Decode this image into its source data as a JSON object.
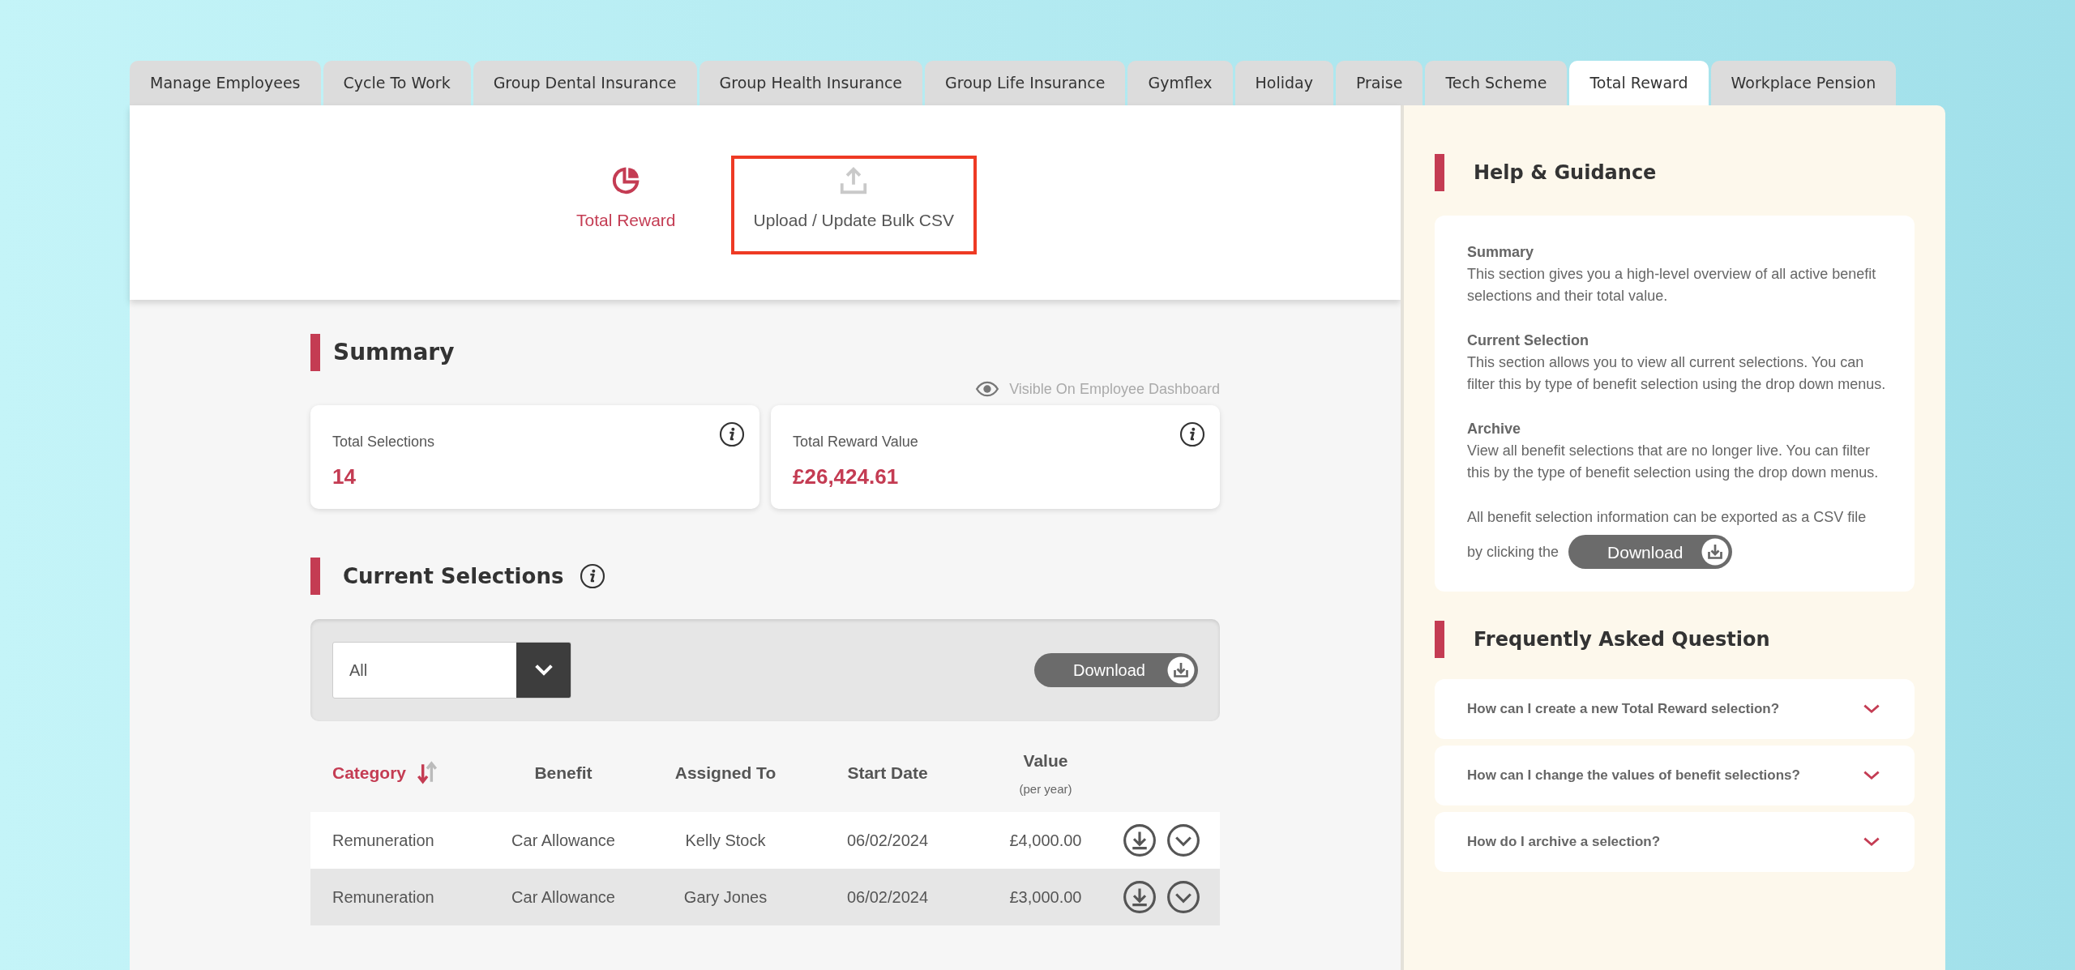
{
  "tabs": [
    {
      "label": "Manage Employees",
      "selected": false
    },
    {
      "label": "Cycle To Work",
      "selected": false
    },
    {
      "label": "Group Dental Insurance",
      "selected": false
    },
    {
      "label": "Group Health Insurance",
      "selected": false
    },
    {
      "label": "Group Life Insurance",
      "selected": false
    },
    {
      "label": "Gymflex",
      "selected": false
    },
    {
      "label": "Holiday",
      "selected": false
    },
    {
      "label": "Praise",
      "selected": false
    },
    {
      "label": "Tech Scheme",
      "selected": false
    },
    {
      "label": "Total Reward",
      "selected": true
    },
    {
      "label": "Workplace Pension",
      "selected": false
    }
  ],
  "nav": [
    {
      "kind": "pie",
      "label": "Total Reward",
      "selected": true,
      "highlighted": false
    },
    {
      "kind": "upload",
      "label": "Upload / Update Bulk CSV",
      "selected": false,
      "highlighted": true
    }
  ],
  "summary": {
    "title": "Summary",
    "visibility": "Visible On Employee Dashboard",
    "cards": [
      {
        "label": "Total Selections",
        "value": "14"
      },
      {
        "label": "Total Reward Value",
        "value": "£26,424.61"
      }
    ]
  },
  "current_selections": {
    "title": "Current Selections",
    "filter": {
      "value": "All"
    },
    "download": "Download",
    "columns": [
      {
        "label": "Category",
        "sorted": true
      },
      {
        "label": "Benefit",
        "sorted": false
      },
      {
        "label": "Assigned To",
        "sorted": false
      },
      {
        "label": "Start Date",
        "sorted": false
      },
      {
        "label": "Value",
        "sublabel": "(per year)",
        "sorted": false
      }
    ],
    "rows": [
      {
        "cells": [
          "Remuneration",
          "Car Allowance",
          "Kelly Stock",
          "06/02/2024",
          "£4,000.00"
        ]
      },
      {
        "cells": [
          "Remuneration",
          "Car Allowance",
          "Gary Jones",
          "06/02/2024",
          "£3,000.00"
        ]
      }
    ]
  },
  "help": {
    "title": "Help & Guidance",
    "sections": [
      {
        "heading": "Summary",
        "text": "This section gives you a high-level overview of all active benefit selections and their total value."
      },
      {
        "heading": "Current Selection",
        "text": "This section allows you to view all current selections. You can filter this by type of benefit selection using the drop down menus."
      },
      {
        "heading": "Archive",
        "text": "View all benefit selections that are no longer live. You can filter this by the type of benefit selection using the drop down menus."
      }
    ],
    "export_text_1": "All benefit selection information can be exported as a CSV file",
    "export_text_2": "by clicking the",
    "download": "Download"
  },
  "faq": {
    "title": "Frequently Asked Question",
    "items": [
      {
        "question": "How can I create a new Total Reward selection?",
        "expanded": false
      },
      {
        "question": "How can I change the values of benefit selections?",
        "expanded": false
      },
      {
        "question": "How do I archive a selection?",
        "expanded": false
      }
    ]
  }
}
